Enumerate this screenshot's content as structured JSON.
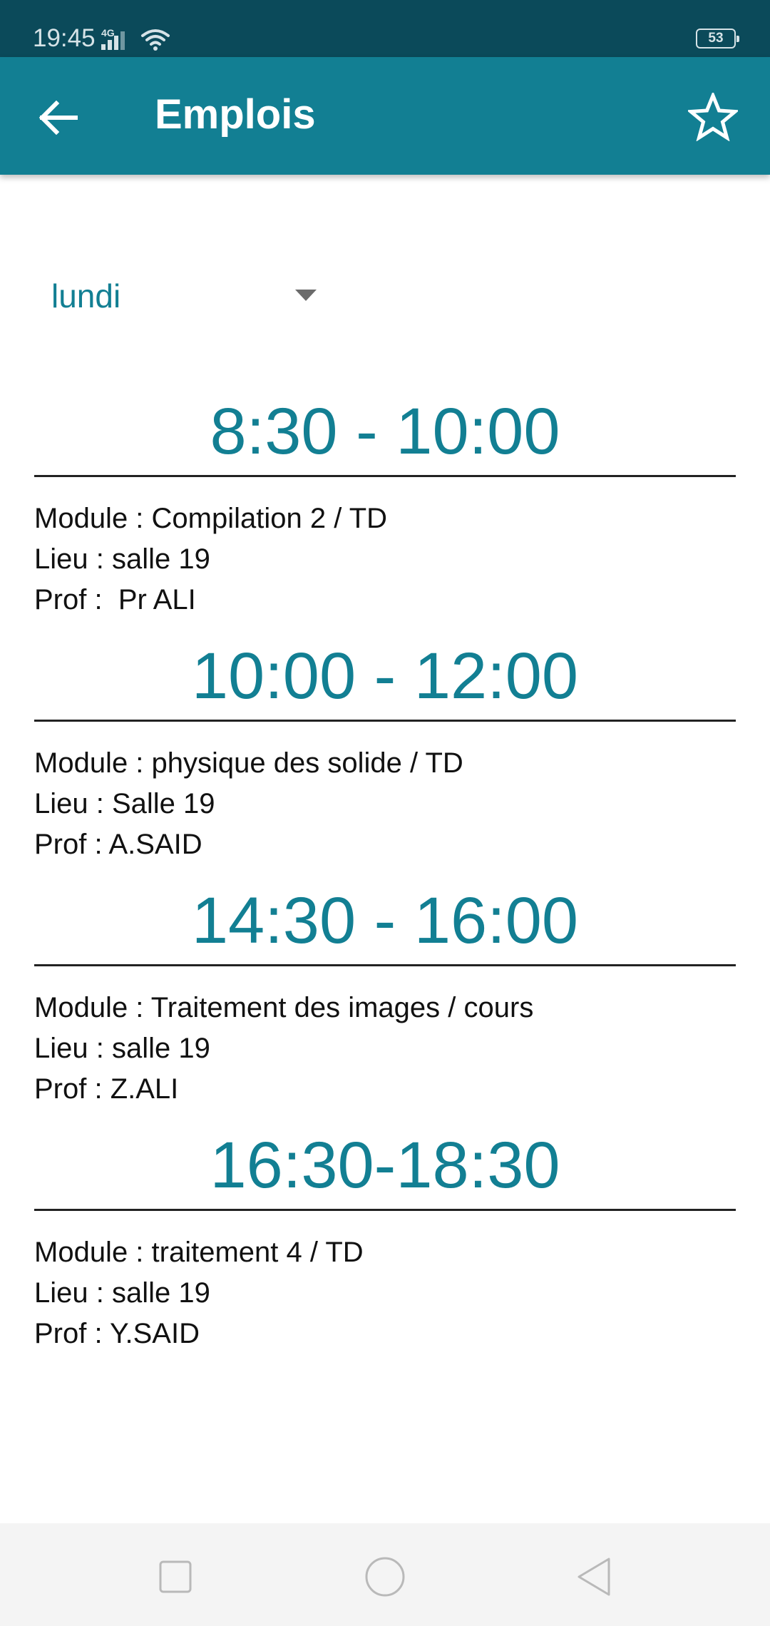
{
  "status_bar": {
    "time": "19:45",
    "network_type": "4G",
    "battery_level": "53",
    "icons": [
      "signal-icon",
      "wifi-icon",
      "battery-icon"
    ]
  },
  "app_bar": {
    "title": "Emplois",
    "back_icon": "arrow-left-icon",
    "favorite_icon": "star-outline-icon"
  },
  "day_selector": {
    "selected": "lundi",
    "icon": "caret-down-icon"
  },
  "schedule": [
    {
      "time": "8:30 - 10:00",
      "module": "Module : Compilation 2 / TD",
      "location": "Lieu : salle 19",
      "professor": "Prof :  Pr ALI"
    },
    {
      "time": "10:00 - 12:00",
      "module": "Module : physique des solide / TD",
      "location": "Lieu : Salle 19",
      "professor": "Prof : A.SAID"
    },
    {
      "time": "14:30 - 16:00",
      "module": "Module : Traitement des images / cours",
      "location": "Lieu : salle 19",
      "professor": "Prof : Z.ALI"
    },
    {
      "time": "16:30-18:30",
      "module": "Module : traitement 4 / TD",
      "location": "Lieu : salle 19",
      "professor": "Prof : Y.SAID"
    }
  ],
  "nav_bar": {
    "icons": [
      "recents-square-icon",
      "home-circle-icon",
      "back-triangle-icon"
    ]
  },
  "colors": {
    "status_bar": "#0b4a5a",
    "app_bar": "#127f93",
    "accent_text": "#127f93",
    "nav_bar": "#f4f4f4"
  }
}
